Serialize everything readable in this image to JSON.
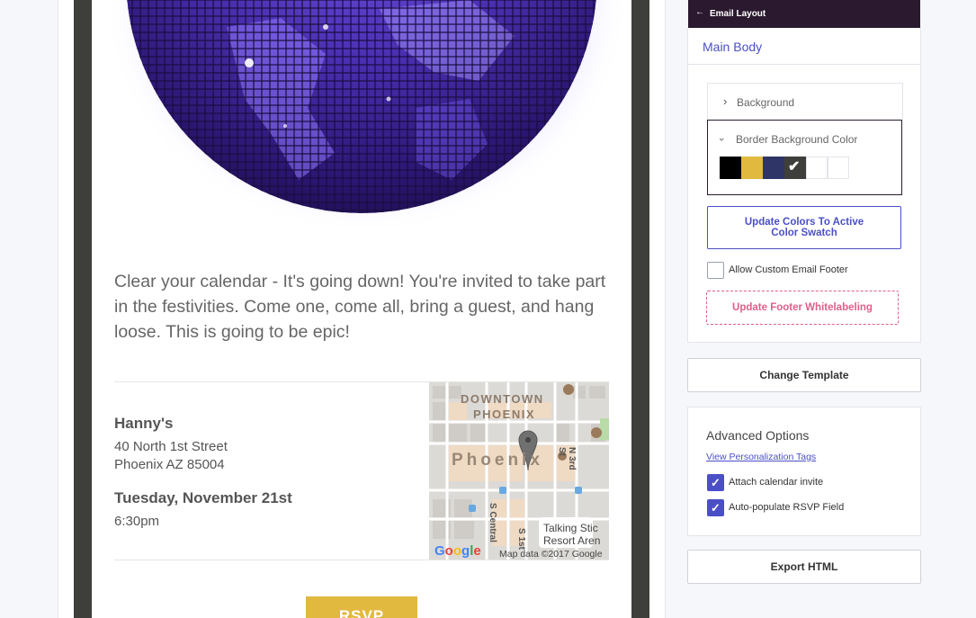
{
  "email": {
    "invite_text": "Clear your calendar - It's going down! You're invited to take part in the festivities. Come one, come all, bring a guest, and hang loose. This is going to be epic!",
    "venue_name": "Hanny's",
    "address_line1": "40 North 1st Street",
    "address_line2": "Phoenix AZ 85004",
    "date": "Tuesday, November 21st",
    "time": "6:30pm",
    "rsvp_label": "RSVP",
    "map": {
      "label_downtown": "DOWNTOWN",
      "label_phoenix_top": "PHOENIX",
      "label_phoenix_big": "Phoenix",
      "label_talking": "Talking Stic",
      "label_resort": "Resort Aren",
      "label_3rd": "N 3rd St",
      "label_central": "S Central",
      "label_1st": "S 1st",
      "google": "Google",
      "attribution": "Map data ©2017 Google"
    }
  },
  "panel": {
    "header_title": "Email Layout",
    "back_icon": "arrow-left-icon",
    "section_title": "Main Body",
    "background_label": "Background",
    "border_bg_label": "Border Background Color",
    "swatches": [
      {
        "color": "#000000",
        "selected": false
      },
      {
        "color": "#e2b93f",
        "selected": false
      },
      {
        "color": "#2f3566",
        "selected": false
      },
      {
        "color": "#3e3f3a",
        "selected": true
      },
      {
        "color": "#ffffff",
        "selected": false
      },
      {
        "color": "#ffffff",
        "selected": false
      }
    ],
    "update_colors_line1": "Update Colors To Active",
    "update_colors_line2": "Color Swatch",
    "custom_footer_label": "Allow Custom Email Footer",
    "custom_footer_checked": false,
    "whitelabel_label": "Update Footer Whitelabeling",
    "change_template_label": "Change Template",
    "advanced_title": "Advanced Options",
    "personalization_link": "View Personalization Tags",
    "calendar_label": "Attach calendar invite",
    "calendar_checked": true,
    "rsvp_field_label": "Auto-populate RSVP Field",
    "rsvp_field_checked": true,
    "export_label": "Export HTML"
  },
  "colors": {
    "accent": "#4b4fc7",
    "header_bg": "#2b1a2f",
    "whitelabel_pink": "#e05f8a",
    "email_border": "#3e3f3a",
    "rsvp_gold": "#e2b93f"
  }
}
